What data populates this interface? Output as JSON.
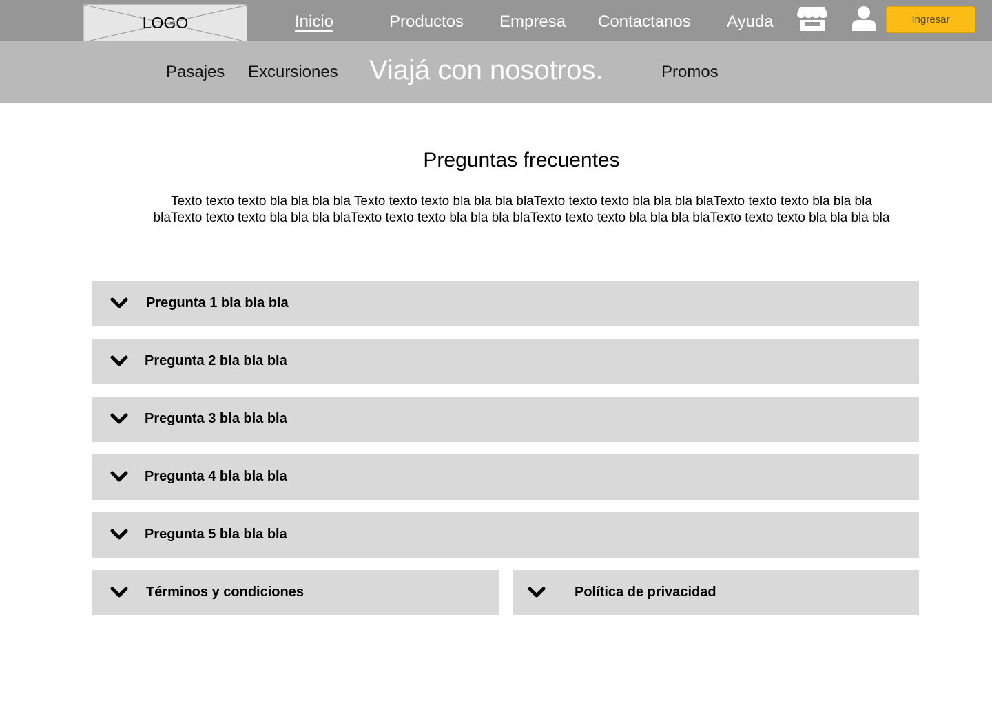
{
  "header": {
    "logo_text": "LOGO",
    "nav": [
      "Inicio",
      "Productos",
      "Empresa",
      "Contactanos",
      "Ayuda"
    ],
    "active_nav": "Inicio",
    "icons": [
      "store-icon",
      "user-icon"
    ],
    "login_label": "Ingresar"
  },
  "subnav": {
    "items": [
      "Pasajes",
      "Excursiones",
      "Promos"
    ],
    "slogan": "Viajá con nosotros."
  },
  "faq": {
    "title": "Preguntas frecuentes",
    "intro": "Texto texto texto bla bla bla bla Texto texto texto bla bla bla blaTexto texto texto bla bla bla blaTexto texto texto bla bla bla blaTexto texto texto bla bla bla blaTexto texto texto bla bla bla blaTexto texto texto bla bla bla blaTexto texto texto bla bla bla bla",
    "questions": [
      "Pregunta 1 bla bla bla",
      "Pregunta 2 bla bla bla",
      "Pregunta 3 bla bla bla",
      "Pregunta 4 bla bla bla",
      "Pregunta 5 bla bla bla"
    ],
    "footer_items": [
      "Términos y condiciones",
      "Política de privacidad"
    ]
  },
  "colors": {
    "topbar": "#969696",
    "subbar": "#b9b9b9",
    "accordion": "#d9d9d9",
    "accent": "#fcbc16"
  }
}
